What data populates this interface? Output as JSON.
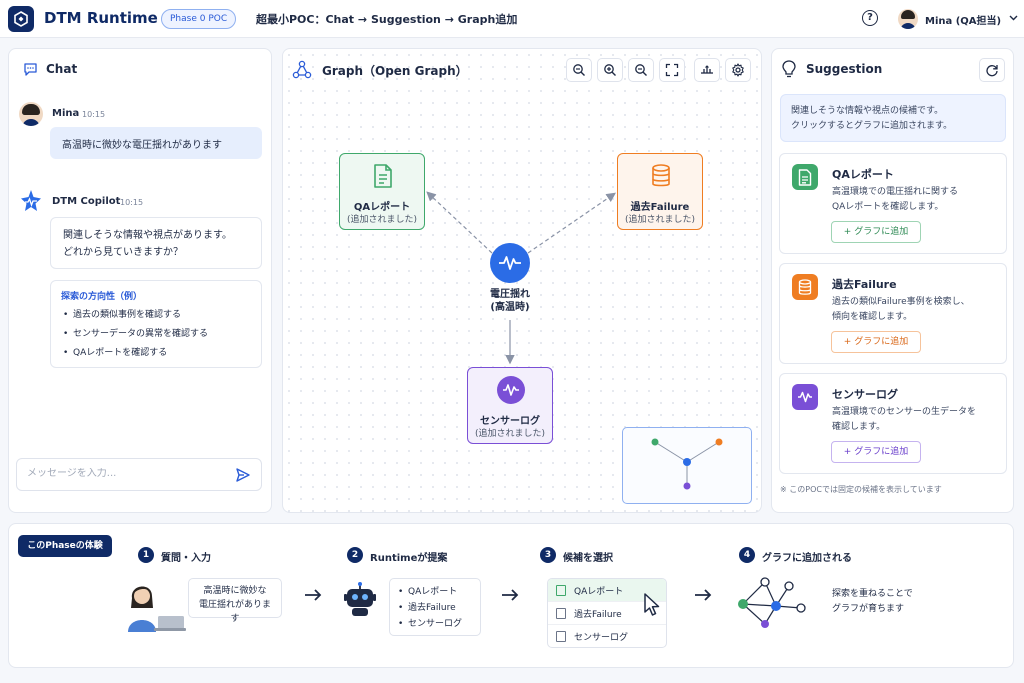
{
  "header": {
    "app_title": "DTM Runtime",
    "phase_badge": "Phase 0 POC",
    "flow_title": "超最小POC：Chat → Suggestion → Graph追加",
    "help_label": "?",
    "user_name": "Mina (QA担当)"
  },
  "chat": {
    "title": "Chat",
    "messages": [
      {
        "sender": "Mina",
        "time": "10:15",
        "text": "高温時に微妙な電圧揺れがあります"
      },
      {
        "sender": "DTM Copilot",
        "time": "10:15",
        "text_lines": [
          "関連しそうな情報や視点があります。",
          "どれから見ていきますか？"
        ]
      }
    ],
    "direction_title": "探索の方向性（例）",
    "direction_items": [
      "過去の類似事例を確認する",
      "センサーデータの異常を確認する",
      "QAレポートを確認する"
    ],
    "input_placeholder": "メッセージを入力..."
  },
  "graph": {
    "title": "Graph（Open Graph）",
    "center_node": {
      "label_line1": "電圧揺れ",
      "label_line2": "(高温時)",
      "color": "#2b6ce6"
    },
    "nodes": [
      {
        "label": "QAレポート",
        "sub": "(追加されました)",
        "color": "#3fa86b"
      },
      {
        "label": "過去Failure",
        "sub": "(追加されました)",
        "color": "#ef7d22"
      },
      {
        "label": "センサーログ",
        "sub": "(追加されました)",
        "color": "#7a4fd6"
      }
    ],
    "toolbar": [
      "zoom-fit-icon",
      "zoom-in-icon",
      "zoom-out-icon",
      "fullscreen-icon",
      "layout-icon",
      "settings-icon"
    ]
  },
  "suggestion": {
    "title": "Suggestion",
    "info_lines": [
      "関連しそうな情報や視点の候補です。",
      "クリックするとグラフに追加されます。"
    ],
    "cards": [
      {
        "title": "QAレポート",
        "desc_lines": [
          "高温環境での電圧揺れに関する",
          "QAレポートを確認します。"
        ],
        "button": "グラフに追加",
        "color": "#3fa86b"
      },
      {
        "title": "過去Failure",
        "desc_lines": [
          "過去の類似Failure事例を検索し、",
          "傾向を確認します。"
        ],
        "button": "グラフに追加",
        "color": "#ef7d22"
      },
      {
        "title": "センサーログ",
        "desc_lines": [
          "高温環境でのセンサーの生データを",
          "確認します。"
        ],
        "button": "グラフに追加",
        "color": "#7a4fd6"
      }
    ],
    "footnote": "※ このPOCでは固定の候補を表示しています"
  },
  "phase": {
    "tag": "このPhaseの体験",
    "steps": [
      {
        "num": "1",
        "label": "質問・入力"
      },
      {
        "num": "2",
        "label": "Runtimeが提案"
      },
      {
        "num": "3",
        "label": "候補を選択"
      },
      {
        "num": "4",
        "label": "グラフに追加される"
      }
    ],
    "speech_lines": [
      "高温時に微妙な",
      "電圧揺れがあります"
    ],
    "proposals": [
      "QAレポート",
      "過去Failure",
      "センサーログ"
    ],
    "select_options": [
      "QAレポート",
      "過去Failure",
      "センサーログ"
    ],
    "note_lines": [
      "探索を重ねることで",
      "グラフが育ちます"
    ]
  }
}
